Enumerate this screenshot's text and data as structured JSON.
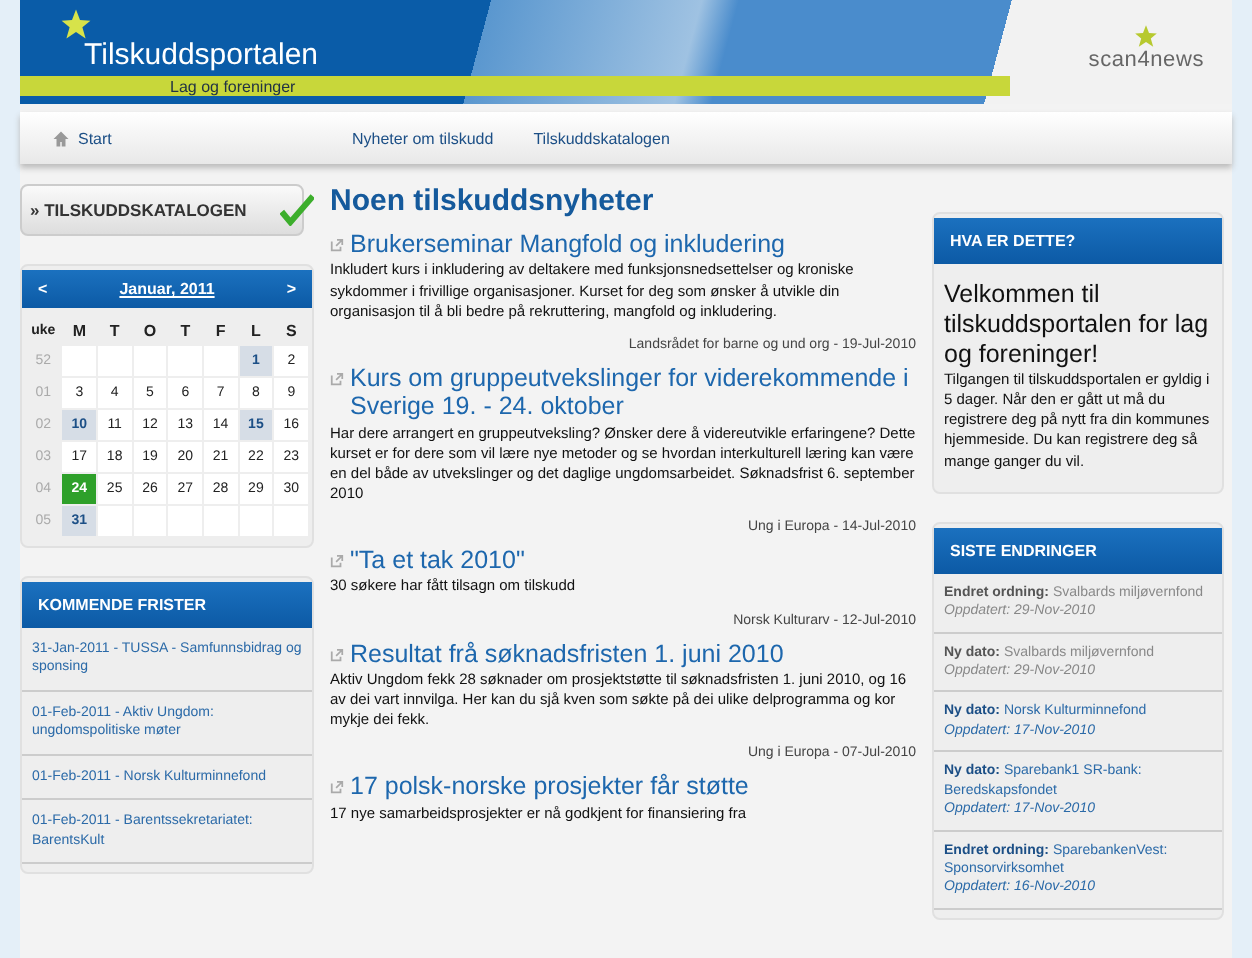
{
  "header": {
    "title": "Tilskuddsportalen",
    "subtitle": "Lag og foreninger",
    "partner_logo": "scan4news"
  },
  "nav": [
    {
      "label": "Start",
      "kind": "home"
    },
    {
      "label": "Nyheter om tilskudd",
      "kind": "link"
    },
    {
      "label": "Tilskuddskatalogen",
      "kind": "link"
    }
  ],
  "catalog_button": {
    "label": "» TILSKUDDSKATALOGEN",
    "checked": true
  },
  "calendar": {
    "prev": "<",
    "month": "Januar, 2011",
    "next": ">",
    "week_header": "uke",
    "weekdays": [
      "M",
      "T",
      "O",
      "T",
      "F",
      "L",
      "S"
    ],
    "weeks": [
      {
        "week": "52",
        "days": [
          {
            "kind": "empty"
          },
          {
            "kind": "empty"
          },
          {
            "kind": "empty"
          },
          {
            "kind": "empty"
          },
          {
            "kind": "empty"
          },
          {
            "day": "1",
            "kind": "event"
          },
          {
            "day": "2",
            "kind": "plain"
          }
        ]
      },
      {
        "week": "01",
        "days": [
          {
            "day": "3",
            "kind": "plain"
          },
          {
            "day": "4",
            "kind": "plain"
          },
          {
            "day": "5",
            "kind": "plain"
          },
          {
            "day": "6",
            "kind": "plain"
          },
          {
            "day": "7",
            "kind": "plain"
          },
          {
            "day": "8",
            "kind": "plain"
          },
          {
            "day": "9",
            "kind": "plain"
          }
        ]
      },
      {
        "week": "02",
        "days": [
          {
            "day": "10",
            "kind": "event"
          },
          {
            "day": "11",
            "kind": "plain"
          },
          {
            "day": "12",
            "kind": "plain"
          },
          {
            "day": "13",
            "kind": "plain"
          },
          {
            "day": "14",
            "kind": "plain"
          },
          {
            "day": "15",
            "kind": "event"
          },
          {
            "day": "16",
            "kind": "plain"
          }
        ]
      },
      {
        "week": "03",
        "days": [
          {
            "day": "17",
            "kind": "plain"
          },
          {
            "day": "18",
            "kind": "plain"
          },
          {
            "day": "19",
            "kind": "plain"
          },
          {
            "day": "20",
            "kind": "plain"
          },
          {
            "day": "21",
            "kind": "plain"
          },
          {
            "day": "22",
            "kind": "plain"
          },
          {
            "day": "23",
            "kind": "plain"
          }
        ]
      },
      {
        "week": "04",
        "days": [
          {
            "day": "24",
            "kind": "today"
          },
          {
            "day": "25",
            "kind": "plain"
          },
          {
            "day": "26",
            "kind": "plain"
          },
          {
            "day": "27",
            "kind": "plain"
          },
          {
            "day": "28",
            "kind": "plain"
          },
          {
            "day": "29",
            "kind": "plain"
          },
          {
            "day": "30",
            "kind": "plain"
          }
        ]
      },
      {
        "week": "05",
        "days": [
          {
            "day": "31",
            "kind": "event"
          },
          {
            "kind": "empty"
          },
          {
            "kind": "empty"
          },
          {
            "kind": "empty"
          },
          {
            "kind": "empty"
          },
          {
            "kind": "empty"
          },
          {
            "kind": "empty"
          }
        ]
      }
    ]
  },
  "deadlines": {
    "title": "KOMMENDE FRISTER",
    "items": [
      "31-Jan-2011 - TUSSA - Samfunnsbidrag og sponsing",
      "01-Feb-2011 - Aktiv Ungdom: ungdomspolitiske møter",
      "01-Feb-2011 - Norsk Kulturminnefond",
      "01-Feb-2011 - Barentssekretariatet: BarentsKult"
    ]
  },
  "news": {
    "title": "Noen tilskuddsnyheter",
    "items": [
      {
        "headline": "Brukerseminar Mangfold og inkludering",
        "body": "Inkludert kurs i inkludering av deltakere med funksjonsnedsettelser og kroniske sykdommer i frivillige organisasjoner. Kurset for deg som ønsker å utvikle din organisasjon til å bli bedre på rekruttering, mangfold og inkludering.",
        "source": "Landsrådet for barne og und org - 19-Jul-2010"
      },
      {
        "headline": "Kurs om gruppeutvekslinger for viderekommende i Sverige 19. - 24. oktober",
        "body": "Har dere arrangert en gruppeutveksling? Ønsker dere å videreutvikle erfaringene? Dette kurset er for dere som vil lære nye metoder og se hvordan interkulturell læring kan være en del både av utvekslinger og det daglige ungdomsarbeidet. Søknadsfrist 6. september 2010",
        "source": "Ung i Europa - 14-Jul-2010"
      },
      {
        "headline": "\"Ta et tak 2010\"",
        "body": "30 søkere har fått tilsagn om tilskudd",
        "source": "Norsk Kulturarv - 12-Jul-2010"
      },
      {
        "headline": "Resultat frå søknadsfristen 1. juni 2010",
        "body": "Aktiv Ungdom fekk 28 søknader om prosjektstøtte til søknadsfristen 1. juni 2010, og 16 av dei vart innvilga. Her kan du sjå kven som søkte på dei ulike delprogramma og kor mykje dei fekk.",
        "source": "Ung i Europa - 07-Jul-2010"
      },
      {
        "headline": "17 polsk-norske prosjekter får støtte",
        "body": "17 nye samarbeidsprosjekter er nå godkjent for finansiering fra"
      }
    ]
  },
  "about": {
    "title": "HVA ER DETTE?",
    "heading": "Velkommen til tilskuddsportalen for lag og foreninger!",
    "text": "Tilgangen til tilskuddsportalen er gyldig i 5 dager. Når den er gått ut må du registrere deg på nytt fra din kommunes hjemmeside. Du kan registrere deg så mange ganger du vil."
  },
  "changes": {
    "title": "SISTE ENDRINGER",
    "items": [
      {
        "type": "Endret ordning:",
        "name": "Svalbards miljøvernfond",
        "updated": "Oppdatert: 29-Nov-2010",
        "visited": true
      },
      {
        "type": "Ny dato:",
        "name": "Svalbards miljøvernfond",
        "updated": "Oppdatert: 29-Nov-2010",
        "visited": true
      },
      {
        "type": "Ny dato:",
        "name": "Norsk Kulturminnefond",
        "updated": "Oppdatert: 17-Nov-2010",
        "visited": false
      },
      {
        "type": "Ny dato:",
        "name": "Sparebank1 SR-bank: Beredskapsfondet",
        "updated": "Oppdatert: 17-Nov-2010",
        "visited": false
      },
      {
        "type": "Endret ordning:",
        "name": "SparebankenVest: Sponsorvirksomhet",
        "updated": "Oppdatert: 16-Nov-2010",
        "visited": false
      }
    ]
  }
}
